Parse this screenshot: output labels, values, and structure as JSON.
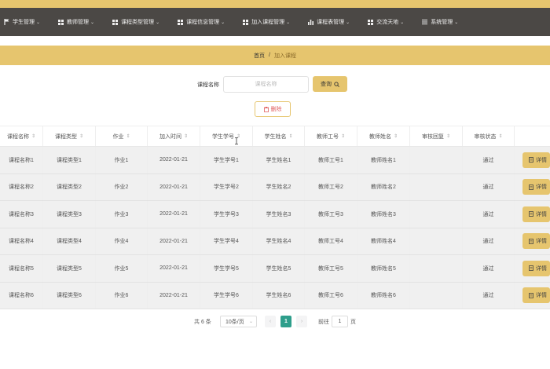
{
  "nav": {
    "items": [
      {
        "label": "学生管理",
        "icon": "flag-icon"
      },
      {
        "label": "教师管理",
        "icon": "grid-icon"
      },
      {
        "label": "课程类型管理",
        "icon": "grid-icon"
      },
      {
        "label": "课程信息管理",
        "icon": "grid-icon"
      },
      {
        "label": "加入课程管理",
        "icon": "grid-icon"
      },
      {
        "label": "课程表管理",
        "icon": "bar-chart-icon"
      },
      {
        "label": "交流天地",
        "icon": "grid-icon"
      },
      {
        "label": "系统管理",
        "icon": "menu-icon"
      }
    ]
  },
  "breadcrumb": {
    "home": "首页",
    "separator": "/",
    "current": "加入课程"
  },
  "search": {
    "label": "课程名称",
    "placeholder": "课程名称",
    "button": "查询"
  },
  "actions": {
    "delete": "删除"
  },
  "table": {
    "headers": [
      "课程名称",
      "课程类型",
      "作业",
      "加入时间",
      "学生学号",
      "学生姓名",
      "教师工号",
      "教师姓名",
      "审核回复",
      "审核状态",
      ""
    ],
    "sortable": [
      true,
      true,
      true,
      true,
      true,
      true,
      true,
      true,
      true,
      true,
      false
    ],
    "rows": [
      [
        "课程名称1",
        "课程类型1",
        "作业1",
        "2022-01-21",
        "学生学号1",
        "学生姓名1",
        "教师工号1",
        "教师姓名1",
        "",
        "通过",
        "详情"
      ],
      [
        "课程名称2",
        "课程类型2",
        "作业2",
        "2022-01-21",
        "学生学号2",
        "学生姓名2",
        "教师工号2",
        "教师姓名2",
        "",
        "通过",
        "详情"
      ],
      [
        "课程名称3",
        "课程类型3",
        "作业3",
        "2022-01-21",
        "学生学号3",
        "学生姓名3",
        "教师工号3",
        "教师姓名3",
        "",
        "通过",
        "详情"
      ],
      [
        "课程名称4",
        "课程类型4",
        "作业4",
        "2022-01-21",
        "学生学号4",
        "学生姓名4",
        "教师工号4",
        "教师姓名4",
        "",
        "通过",
        "详情"
      ],
      [
        "课程名称5",
        "课程类型5",
        "作业5",
        "2022-01-21",
        "学生学号5",
        "学生姓名5",
        "教师工号5",
        "教师姓名5",
        "",
        "通过",
        "详情"
      ],
      [
        "课程名称6",
        "课程类型6",
        "作业6",
        "2022-01-21",
        "学生学号6",
        "学生姓名6",
        "教师工号6",
        "教师姓名6",
        "",
        "通过",
        "详情"
      ]
    ]
  },
  "pagination": {
    "total": "共 6 条",
    "page_size": "10条/页",
    "current_page": "1",
    "goto_label": "前往",
    "goto_value": "1",
    "page_unit": "页"
  },
  "colors": {
    "accent": "#e6c56e",
    "nav_bg": "#4b4845",
    "active_page": "#2e9e8b"
  }
}
